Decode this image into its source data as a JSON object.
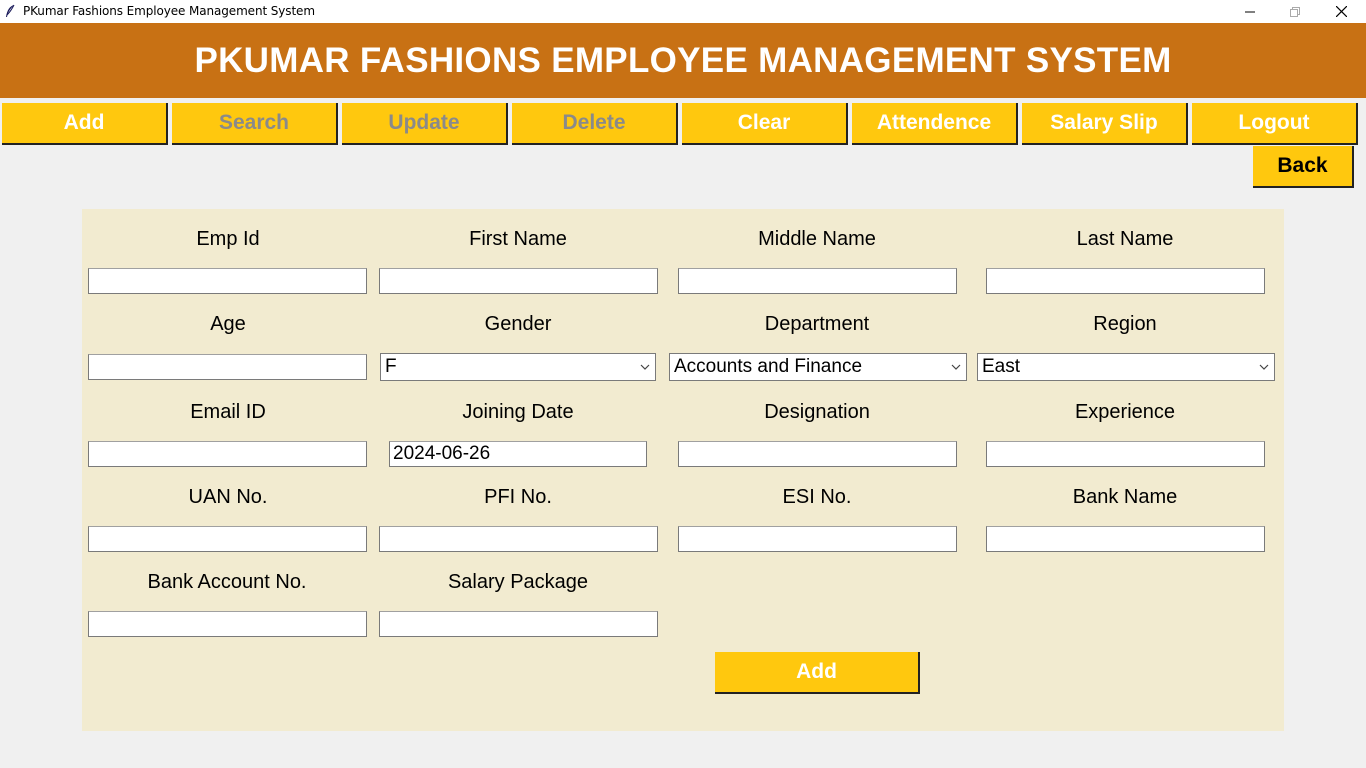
{
  "window": {
    "title": "PKumar Fashions Employee Management System",
    "app_icon": "feather-icon",
    "controls": [
      "minimize-icon",
      "maximize-icon",
      "close-icon"
    ]
  },
  "header": {
    "title": "PKUMAR FASHIONS EMPLOYEE MANAGEMENT SYSTEM",
    "bg_color": "#c87114"
  },
  "toolbar": {
    "accent_color": "#ffc80e",
    "buttons": [
      {
        "label": "Add",
        "enabled": true
      },
      {
        "label": "Search",
        "enabled": false
      },
      {
        "label": "Update",
        "enabled": false
      },
      {
        "label": "Delete",
        "enabled": false
      },
      {
        "label": "Clear",
        "enabled": true
      },
      {
        "label": "Attendence",
        "enabled": true
      },
      {
        "label": "Salary Slip",
        "enabled": true
      },
      {
        "label": "Logout",
        "enabled": true
      }
    ],
    "back_label": "Back"
  },
  "form": {
    "fields": {
      "emp_id": {
        "label": "Emp Id",
        "value": ""
      },
      "first_name": {
        "label": "First Name",
        "value": ""
      },
      "middle_name": {
        "label": "Middle Name",
        "value": ""
      },
      "last_name": {
        "label": "Last Name",
        "value": ""
      },
      "age": {
        "label": "Age",
        "value": ""
      },
      "gender": {
        "label": "Gender",
        "value": "F"
      },
      "department": {
        "label": "Department",
        "value": "Accounts and Finance"
      },
      "region": {
        "label": "Region",
        "value": "East"
      },
      "email": {
        "label": "Email ID",
        "value": ""
      },
      "joining_date": {
        "label": "Joining Date",
        "value": "2024-06-26"
      },
      "designation": {
        "label": "Designation",
        "value": ""
      },
      "experience": {
        "label": "Experience",
        "value": ""
      },
      "uan": {
        "label": "UAN No.",
        "value": ""
      },
      "pfi": {
        "label": "PFI No.",
        "value": ""
      },
      "esi": {
        "label": "ESI No.",
        "value": ""
      },
      "bank_name": {
        "label": "Bank Name",
        "value": ""
      },
      "bank_account": {
        "label": "Bank Account No.",
        "value": ""
      },
      "salary_package": {
        "label": "Salary Package",
        "value": ""
      }
    },
    "submit_label": "Add",
    "panel_color": "#f2ebd0"
  }
}
